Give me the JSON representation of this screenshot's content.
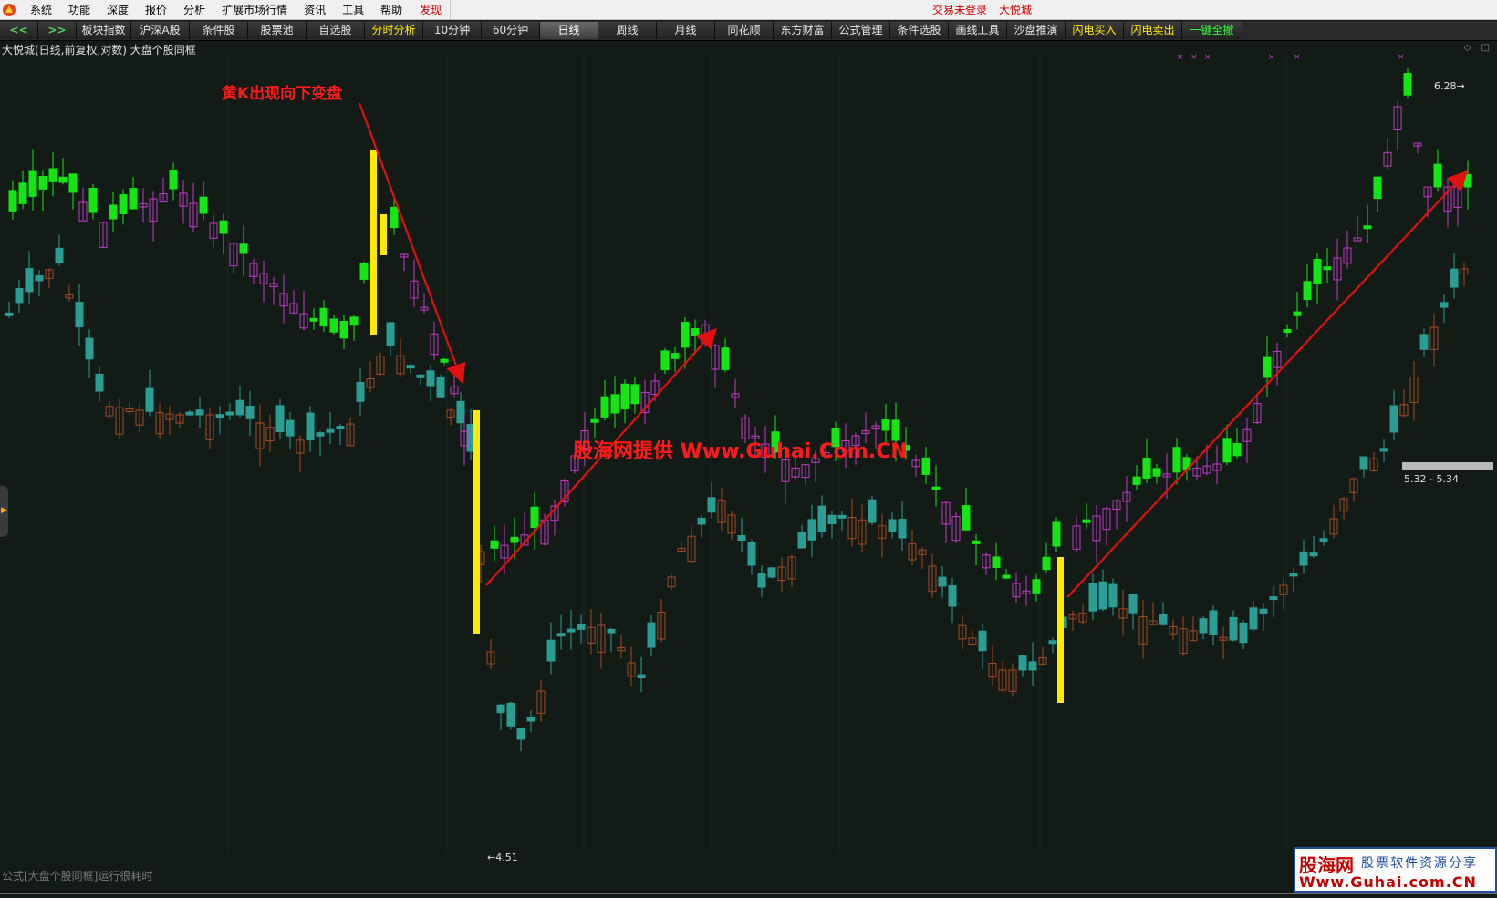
{
  "menubar": {
    "items": [
      "系统",
      "功能",
      "深度",
      "报价",
      "分析",
      "扩展市场行情",
      "资讯",
      "工具",
      "帮助"
    ],
    "discover_label": "发现",
    "login_status": "交易未登录",
    "username": "大悦城"
  },
  "toolbar": {
    "back": "<<",
    "forward": ">>",
    "buttons": [
      "板块指数",
      "沪深A股",
      "条件股",
      "股票池",
      "自选股",
      "分时分析",
      "10分钟",
      "60分钟",
      "日线",
      "周线",
      "月线",
      "同花顺",
      "东方财富",
      "公式管理",
      "条件选股",
      "画线工具",
      "沙盘推演",
      "闪电买入",
      "闪电卖出",
      "一键全撤"
    ],
    "active": "日线"
  },
  "chart": {
    "title": "大悦城(日线,前复权,对数) 大盘个股同框",
    "annotation_yellow_k": "黄K出现向下变盘",
    "watermark": "股海网提供 Www.Guhai.Com.CN",
    "low_label": "←4.51",
    "high_label": "6.28→",
    "range_label": "5.32 - 5.34",
    "status_text": "公式[大盘个股同框]运行很耗时",
    "colors": {
      "background": "#131b17",
      "up_magenta": "#c33ac9",
      "down_green": "#14e614",
      "index_teal": "#2a9e95",
      "index_orange": "#a34a22",
      "yellow_k": "#ffea00",
      "arrow_red": "#e01010",
      "menu_red": "#d40000"
    }
  },
  "logo": {
    "main": "股海网",
    "slogan": "股票软件资源分享",
    "url": "Www.Guhai.com.CN"
  },
  "icons": {
    "app": "app-logo-icon",
    "left_handle": "expand-arrow-icon",
    "window": "window-control-icons"
  }
}
